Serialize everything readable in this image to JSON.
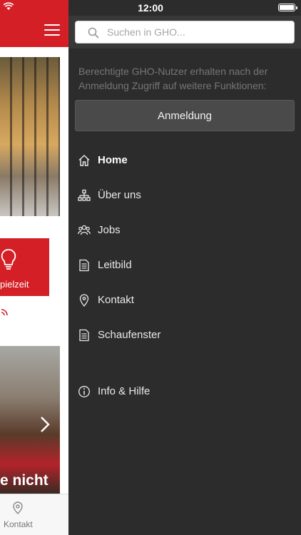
{
  "status_bar": {
    "time": "12:00"
  },
  "search": {
    "placeholder": "Suchen in GHO..."
  },
  "login": {
    "info_text": "Berechtigte GHO-Nutzer erhalten nach der Anmeldung Zugriff auf weitere Funktionen:",
    "button_label": "Anmeldung"
  },
  "menu": {
    "items": [
      {
        "label": "Home",
        "icon": "home-icon",
        "active": true
      },
      {
        "label": "Über uns",
        "icon": "org-chart-icon"
      },
      {
        "label": "Jobs",
        "icon": "people-icon"
      },
      {
        "label": "Leitbild",
        "icon": "document-icon"
      },
      {
        "label": "Kontakt",
        "icon": "location-pin-icon"
      },
      {
        "label": "Schaufenster",
        "icon": "document-icon"
      },
      {
        "label": "Info & Hilfe",
        "icon": "info-icon"
      }
    ]
  },
  "background_app": {
    "tile_label": "pielzeit",
    "photo_caption": "e nicht",
    "tab_label": "Kontakt",
    "brand_color": "#d41f26"
  }
}
